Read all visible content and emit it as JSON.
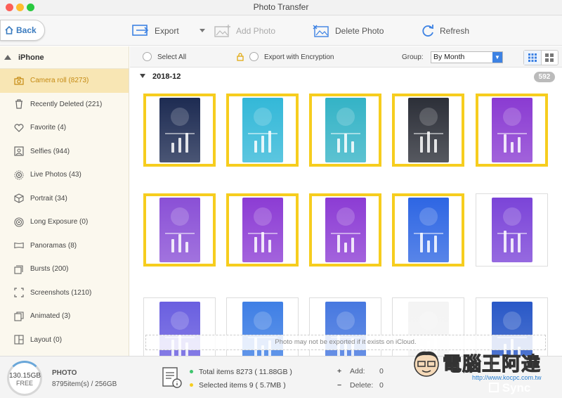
{
  "window": {
    "title": "Photo Transfer"
  },
  "toolbar": {
    "back_label": "Back",
    "export_label": "Export",
    "add_photo_label": "Add Photo",
    "delete_photo_label": "Delete Photo",
    "refresh_label": "Refresh"
  },
  "sidebar": {
    "device": "iPhone",
    "items": [
      {
        "label": "Camera roll (8273)",
        "icon": "camera-icon"
      },
      {
        "label": "Recently Deleted (221)",
        "icon": "trash-icon"
      },
      {
        "label": "Favorite (4)",
        "icon": "heart-icon"
      },
      {
        "label": "Selfies (944)",
        "icon": "selfie-icon"
      },
      {
        "label": "Live Photos (43)",
        "icon": "live-photo-icon"
      },
      {
        "label": "Portrait (34)",
        "icon": "cube-icon"
      },
      {
        "label": "Long Exposure (0)",
        "icon": "long-exposure-icon"
      },
      {
        "label": "Panoramas (8)",
        "icon": "panorama-icon"
      },
      {
        "label": "Bursts (200)",
        "icon": "bursts-icon"
      },
      {
        "label": "Screenshots (1210)",
        "icon": "screenshot-icon"
      },
      {
        "label": "Animated (3)",
        "icon": "animated-icon"
      },
      {
        "label": "Layout (0)",
        "icon": "layout-icon"
      }
    ]
  },
  "options": {
    "select_all": "Select All",
    "export_encryption": "Export with Encryption",
    "group_label": "Group:",
    "group_value": "By Month"
  },
  "group": {
    "label": "2018-12",
    "count": "592"
  },
  "icloud_note": "Photo may not be exported if it exists on iCloud.",
  "thumbnails": {
    "row1": [
      {
        "selected": true,
        "color": "#1d2b52"
      },
      {
        "selected": true,
        "color": "#33b8d8"
      },
      {
        "selected": true,
        "color": "#34b3c6"
      },
      {
        "selected": true,
        "color": "#2c2f38"
      },
      {
        "selected": true,
        "color": "#8a3bd2"
      }
    ],
    "row2": [
      {
        "selected": true,
        "color": "#8a50d6"
      },
      {
        "selected": true,
        "color": "#8c3cd4"
      },
      {
        "selected": true,
        "color": "#8c3cd4"
      },
      {
        "selected": true,
        "color": "#2e66e3"
      },
      {
        "selected": false,
        "color": "#7b44d8"
      }
    ],
    "row3": [
      {
        "selected": false,
        "color": "#6a5fe0"
      },
      {
        "selected": false,
        "color": "#3f7fe5"
      },
      {
        "selected": false,
        "color": "#4778e0"
      },
      {
        "selected": false,
        "color": "#f4f4f4"
      },
      {
        "selected": false,
        "color": "#2958c7"
      }
    ]
  },
  "footer": {
    "storage_size": "130.15GB",
    "storage_free": "FREE",
    "photo_label": "PHOTO",
    "photo_count": "8795item(s) / 256GB",
    "total_items": "Total items 8273 ( 11.88GB )",
    "selected_items": "Selected items 9 ( 5.7MB )",
    "add_label": "Add:",
    "add_value": "0",
    "delete_label": "Delete:",
    "delete_value": "0",
    "sync_label": "Sync"
  },
  "watermark": {
    "text": "電腦王阿達",
    "url": "http://www.kocpc.com.tw"
  },
  "colors": {
    "accent": "#3d82e3",
    "selection": "#f6cd1e",
    "sidebar_active": "#f8e6b4",
    "sidebar_bg": "#fbf8ee"
  }
}
